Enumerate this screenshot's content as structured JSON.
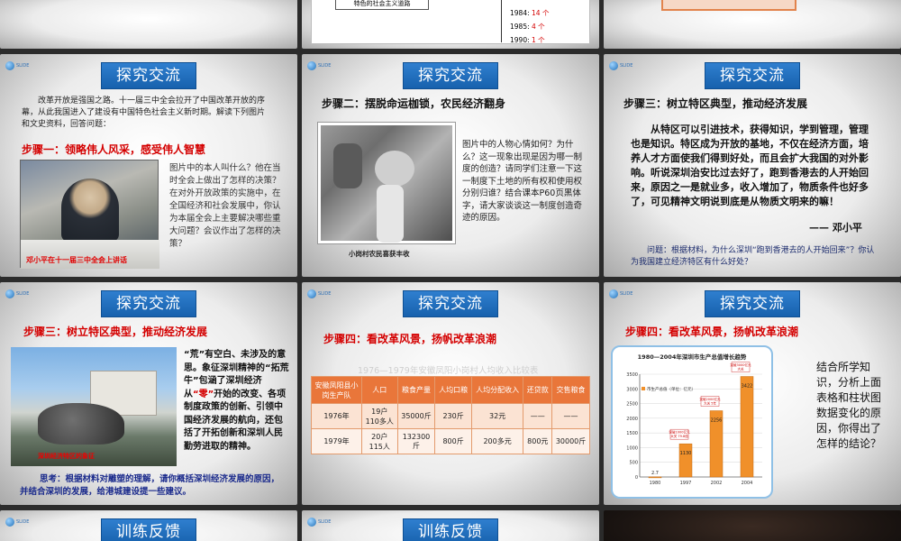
{
  "slides": {
    "top_middle": {
      "box_text": "特色的社会主义道路",
      "list": [
        {
          "year": "1984:",
          "value": "14 个"
        },
        {
          "year": "1985:",
          "value": "4 个"
        },
        {
          "year": "1990:",
          "value": "1 个"
        }
      ]
    },
    "s4": {
      "title": "探究交流",
      "intro": "改革开放是强国之路。十一届三中全会拉开了中国改革开放的序幕，从此我国进入了建设有中国特色社会主义新时期。解读下列图片和文史资料，回答问题：",
      "step": "步骤一：领略伟人风采，感受伟人智慧",
      "body": "图片中的本人叫什么？他在当时全会上做出了怎样的决策？在对外开放政策的实施中，在全国经济和社会发展中，你认为本届全会上主要解决哪些重大问题？会议作出了怎样的决策？",
      "caption": "邓小平在十一届三中全会上讲话"
    },
    "s5": {
      "title": "探究交流",
      "step": "步骤二：摆脱命运枷锁，农民经济翻身",
      "body": "图片中的人物心情如何？为什么？这一现象出现是因为哪一制度的创造？请同学们注意一下这一制度下土地的所有权和使用权分别归谁？结合课本P60页黑体字，请大家谈谈这一制度创造奇迹的原因。",
      "caption": "小岗村农民喜获丰收"
    },
    "s6": {
      "title": "探究交流",
      "step": "步骤三：树立特区典型，推动经济发展",
      "quote": "从特区可以引进技术，获得知识，学到管理，管理也是知识。特区成为开放的基地，不仅在经济方面，培养人才方面使我们得到好处，而且会扩大我国的对外影响。听说深圳治安比过去好了，跑到香港去的人开始回来，原因之一是就业多，收入增加了，物质条件也好多了，可见精神文明说到底是从物质文明来的嘛！",
      "author": "—— 邓小平",
      "question": "问题：根据材料，为什么深圳“跑到香港去的人开始回来”？你认为我国建立经济特区有什么好处？"
    },
    "s7": {
      "title": "探究交流",
      "step": "步骤三：树立特区典型，推动经济发展",
      "body_a": "“荒”有空白、未涉及的意思。象征深圳精神的“拓荒牛”包涵了深圳经济从",
      "body_mark": "“零”",
      "body_b": "开始的改变、各项制度政策的创新、引领中国经济发展的航向，还包括了开拓创新和深圳人民勤劳进取的精神。",
      "think": "思考：根据材料对雕塑的理解，请你概括深圳经济发展的原因，并结合深圳的发展，给港城建设提一些建议。",
      "photo_caption": "深圳经济特区的象征"
    },
    "s8": {
      "title": "探究交流",
      "step": "步骤四：看改革风景，扬帆改革浪潮",
      "table_title": "1976—1979年安徽凤阳小岗村人均收入比较表",
      "headers": [
        "安徽凤阳县小岗生产队",
        "人口",
        "粮食产量",
        "人均口粮",
        "人均分配收入",
        "还贷款",
        "交售粮食"
      ],
      "rows": [
        [
          "1976年",
          "19户\n110多人",
          "35000斤",
          "230斤",
          "32元",
          "——",
          "——"
        ],
        [
          "1979年",
          "20户\n115人",
          "132300\n斤",
          "800斤",
          "200多元",
          "800元",
          "30000斤"
        ]
      ]
    },
    "s9": {
      "title": "探究交流",
      "step": "步骤四：看改革风景，扬帆改革浪潮",
      "side_text": "结合所学知识，分析上面表格和柱状图数据变化的原因，你得出了怎样的结论？"
    },
    "s10": {
      "title": "训练反馈"
    },
    "s11": {
      "title": "训练反馈"
    }
  },
  "chart_data": {
    "type": "bar",
    "title": "1980—2004年深圳市生产总值增长趋势",
    "legend": "市生产总值（单位：亿元）",
    "categories": [
      "1980",
      "1997",
      "2002",
      "2004"
    ],
    "values": [
      2.7,
      1130,
      2256,
      3422
    ],
    "value_labels": [
      "2.7",
      "1130",
      "2256",
      "3422"
    ],
    "yticks": [
      "0",
      "500",
      "1000",
      "1500",
      "2000",
      "2500",
      "3000",
      "3500"
    ],
    "ylim": [
      0,
      3500
    ],
    "callouts": [
      "突破1000亿元\n大关 79.8倍",
      "突破2000亿元\n大关 5年",
      "突破3000亿元\n大关"
    ],
    "bar_color": "#f0902a"
  }
}
